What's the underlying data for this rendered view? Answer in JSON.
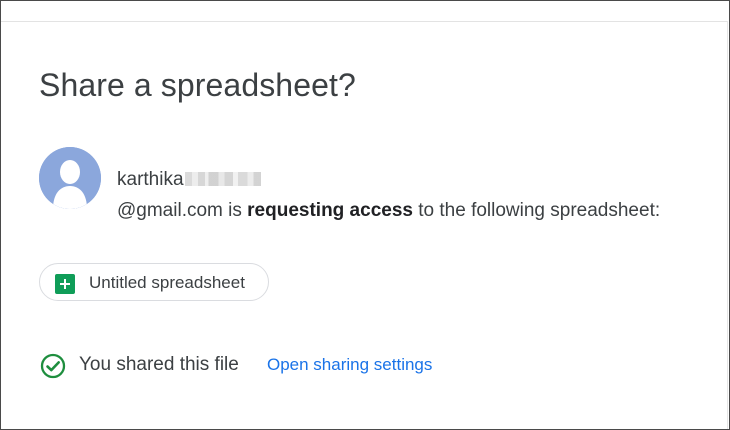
{
  "dialog": {
    "title": "Share a spreadsheet?"
  },
  "request": {
    "email_user": "karthika",
    "email_domain": "@gmail.com",
    "text_before_bold": " is ",
    "bold_text": "requesting access",
    "text_after_bold": " to the following spreadsheet:"
  },
  "file": {
    "name": "Untitled spreadsheet",
    "icon": "google-sheets-icon"
  },
  "status": {
    "icon": "check-circle-icon",
    "text": "You shared this file",
    "link_label": "Open sharing settings"
  },
  "icons": {
    "avatar": "avatar-icon"
  },
  "colors": {
    "title": "#3c4043",
    "text": "#3c4043",
    "link": "#1a73e8",
    "sheets_green": "#0f9d58",
    "check_green": "#1e8e3e",
    "avatar_bg": "#8ba7dc",
    "avatar_fg": "#ffffff",
    "chip_border": "#dadce0"
  }
}
